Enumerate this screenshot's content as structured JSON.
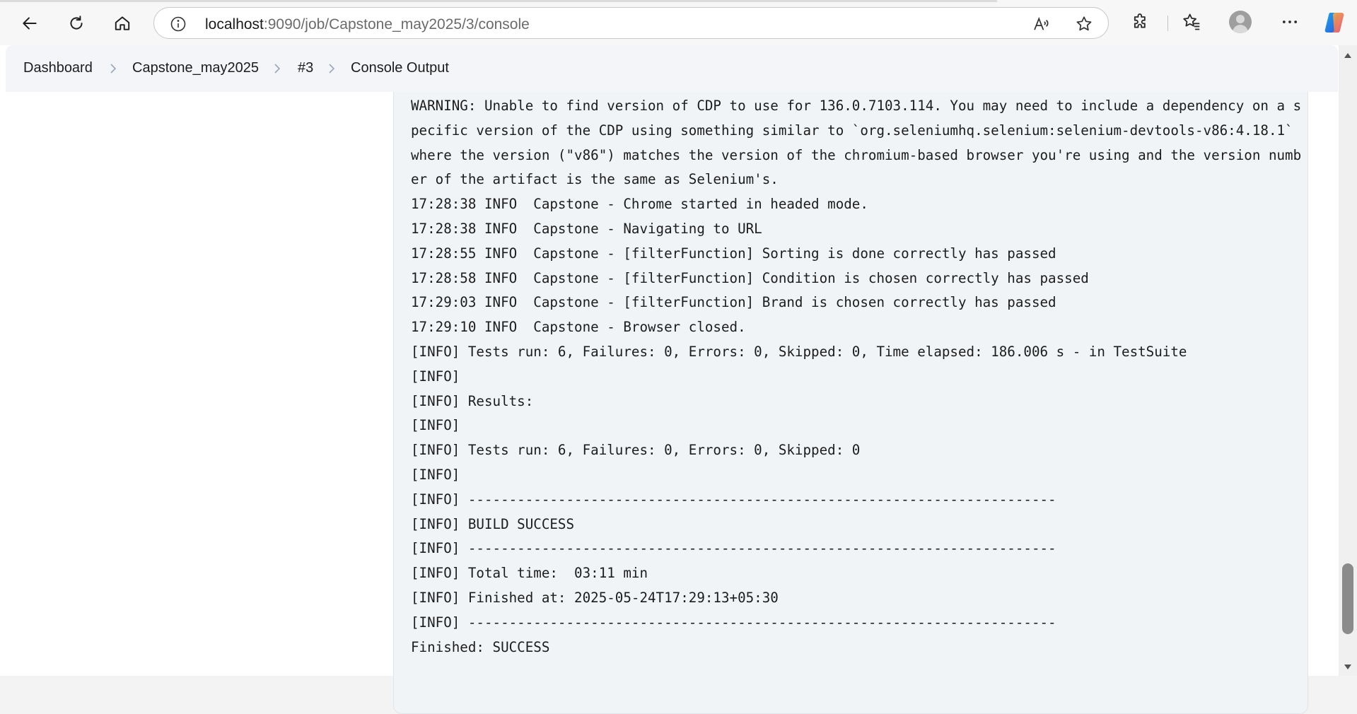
{
  "browser": {
    "url_host": "localhost",
    "url_path": ":9090/job/Capstone_may2025/3/console"
  },
  "breadcrumb": {
    "items": [
      "Dashboard",
      "Capstone_may2025",
      "#3",
      "Console Output"
    ]
  },
  "console": {
    "lines": [
      "WARNING: Unable to find version of CDP to use for 136.0.7103.114. You may need to include a dependency on a specific version of the CDP using something similar to `org.seleniumhq.selenium:selenium-devtools-v86:4.18.1` where the version (\"v86\") matches the version of the chromium-based browser you're using and the version number of the artifact is the same as Selenium's.",
      "17:28:38 INFO  Capstone - Chrome started in headed mode.",
      "17:28:38 INFO  Capstone - Navigating to URL",
      "17:28:55 INFO  Capstone - [filterFunction] Sorting is done correctly has passed",
      "17:28:58 INFO  Capstone - [filterFunction] Condition is chosen correctly has passed",
      "17:29:03 INFO  Capstone - [filterFunction] Brand is chosen correctly has passed",
      "17:29:10 INFO  Capstone - Browser closed.",
      "[INFO] Tests run: 6, Failures: 0, Errors: 0, Skipped: 0, Time elapsed: 186.006 s - in TestSuite",
      "[INFO]",
      "[INFO] Results:",
      "[INFO]",
      "[INFO] Tests run: 6, Failures: 0, Errors: 0, Skipped: 0",
      "[INFO]",
      "[INFO] ------------------------------------------------------------------------",
      "[INFO] BUILD SUCCESS",
      "[INFO] ------------------------------------------------------------------------",
      "[INFO] Total time:  03:11 min",
      "[INFO] Finished at: 2025-05-24T17:29:13+05:30",
      "[INFO] ------------------------------------------------------------------------",
      "Finished: SUCCESS"
    ]
  },
  "icons": {
    "back": "back-arrow-icon",
    "refresh": "refresh-icon",
    "home": "home-icon",
    "info": "site-info-icon",
    "read_aloud": "read-aloud-icon",
    "favorite": "star-icon",
    "extensions": "puzzle-icon",
    "favorites": "favorites-icon",
    "profile": "profile-icon",
    "more": "more-icon",
    "copilot": "copilot-icon"
  }
}
